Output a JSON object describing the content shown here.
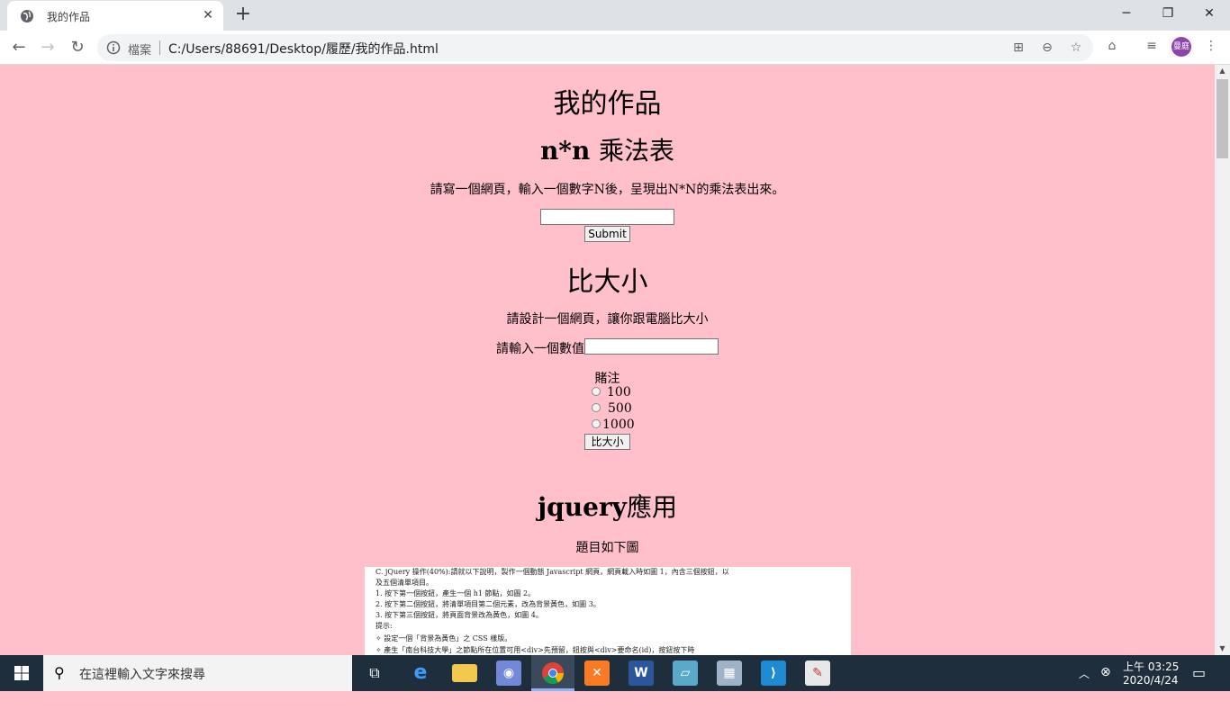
{
  "browser": {
    "tab_title": "我的作品",
    "scheme_label": "檔案",
    "url": "C:/Users/88691/Desktop/履歷/我的作品.html",
    "avatar_text": "曼庭"
  },
  "page": {
    "title": "我的作品",
    "section1": {
      "heading_latin": "n*n",
      "heading_cjk": "乘法表",
      "description": "請寫一個網頁，輸入一個數字N後，呈現出N*N的乘法表出來。",
      "input_value": "",
      "submit_label": "Submit"
    },
    "section2": {
      "heading": "比大小",
      "description": "請設計一個網頁，讓你跟電腦比大小",
      "input_label": "請輸入一個數值",
      "input_value": "",
      "bet_label": "賭注",
      "options": [
        "100",
        "500",
        "1000"
      ],
      "button_label": "比大小"
    },
    "section3": {
      "heading_latin": "jquery",
      "heading_cjk": "應用",
      "description": "題目如下圖",
      "image_lines": [
        "C.    jQuery 操作(40%):請就以下說明，製作一個動態 Javascript 網頁，網頁載入時如圖 1，內含三個按鈕，以",
        "        及五個清單項目。",
        "  1.   按下第一個按鈕，產生一個 h1 節點，如圖 2。",
        "  2.   按下第二個按鈕，將清單項目第二個元素，改為背景黃色，如圖 3。",
        "  3.   按下第三個按鈕，將頁面背景改為黃色，如圖 4。",
        "     提示:",
        "          ✧      設定一個「背景為黃色」之 CSS 樣版。",
        "          ✧      產生「南台科技大學」之節點所在位置可用<div>先預留，鈕按與<div>要命名(id)，按鈕按下時"
      ]
    }
  },
  "taskbar": {
    "search_placeholder": "在這裡輸入文字來搜尋",
    "time": "上午 03:25",
    "date": "2020/4/24"
  },
  "colors": {
    "page_background": "#ffc0cb",
    "taskbar": "#1f2e3d"
  }
}
